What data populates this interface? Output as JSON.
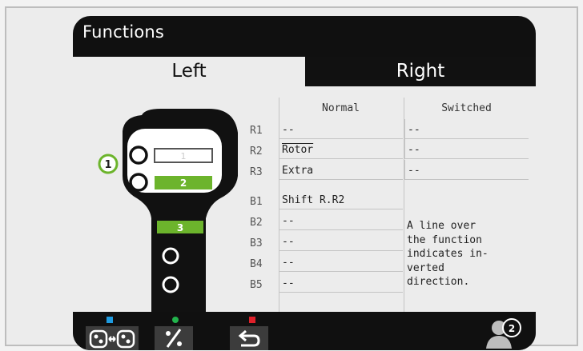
{
  "title": "Functions",
  "tabs": {
    "left": "Left",
    "right": "Right"
  },
  "table": {
    "headers": {
      "normal": "Normal",
      "switched": "Switched"
    },
    "rows": [
      {
        "label": "R1",
        "normal": "--",
        "switched": "--"
      },
      {
        "label": "R2",
        "normal": "Rotor",
        "switched": "--"
      },
      {
        "label": "R3",
        "normal": "Extra",
        "switched": "--"
      },
      {
        "label": "B1",
        "normal": "Shift R.R2",
        "switched": ""
      },
      {
        "label": "B2",
        "normal": "--",
        "switched": ""
      },
      {
        "label": "B3",
        "normal": "--",
        "switched": ""
      },
      {
        "label": "B4",
        "normal": "--",
        "switched": ""
      },
      {
        "label": "B5",
        "normal": "--",
        "switched": ""
      }
    ],
    "note": [
      "A line over",
      "the function",
      "indicates in-",
      "verted",
      "direction."
    ]
  },
  "controller": {
    "selected_marker": "1",
    "slots": [
      "1",
      "2",
      "3"
    ]
  },
  "bottom_bar": {
    "colors": {
      "blue": "#1e9be0",
      "green": "#22b34c",
      "red": "#e0202a"
    },
    "icons": [
      "swap-controller-icon",
      "percent-icon",
      "back-arrow-icon",
      "user-profile-icon"
    ],
    "user_badge": "2"
  },
  "colors": {
    "accent_green": "#6cb42c",
    "screen_bg": "#101010",
    "panel_bg": "#ececec"
  }
}
